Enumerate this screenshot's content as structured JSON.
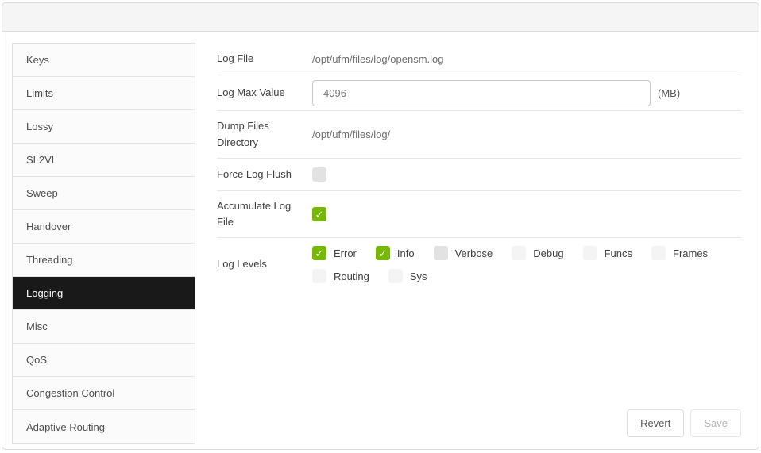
{
  "sidebar": {
    "items": [
      {
        "label": "Keys",
        "selected": false
      },
      {
        "label": "Limits",
        "selected": false
      },
      {
        "label": "Lossy",
        "selected": false
      },
      {
        "label": "SL2VL",
        "selected": false
      },
      {
        "label": "Sweep",
        "selected": false
      },
      {
        "label": "Handover",
        "selected": false
      },
      {
        "label": "Threading",
        "selected": false
      },
      {
        "label": "Logging",
        "selected": true
      },
      {
        "label": "Misc",
        "selected": false
      },
      {
        "label": "QoS",
        "selected": false
      },
      {
        "label": "Congestion Control",
        "selected": false
      },
      {
        "label": "Adaptive Routing",
        "selected": false
      }
    ]
  },
  "form": {
    "log_file": {
      "label": "Log File",
      "value": "/opt/ufm/files/log/opensm.log"
    },
    "log_max_value": {
      "label": "Log Max Value",
      "value": "4096",
      "unit": "(MB)"
    },
    "dump_files_directory": {
      "label": "Dump Files Directory",
      "value": "/opt/ufm/files/log/"
    },
    "force_log_flush": {
      "label": "Force Log Flush",
      "checked": false
    },
    "accumulate_log_file": {
      "label": "Accumulate Log File",
      "checked": true
    },
    "log_levels": {
      "label": "Log Levels",
      "options": [
        {
          "label": "Error",
          "checked": true
        },
        {
          "label": "Info",
          "checked": true
        },
        {
          "label": "Verbose",
          "checked": false
        },
        {
          "label": "Debug",
          "checked": false
        },
        {
          "label": "Funcs",
          "checked": false
        },
        {
          "label": "Frames",
          "checked": false
        },
        {
          "label": "Routing",
          "checked": false
        },
        {
          "label": "Sys",
          "checked": false
        }
      ]
    }
  },
  "footer": {
    "revert_label": "Revert",
    "save_label": "Save"
  },
  "colors": {
    "accent_green": "#76b900",
    "selected_item_bg": "#191919"
  }
}
